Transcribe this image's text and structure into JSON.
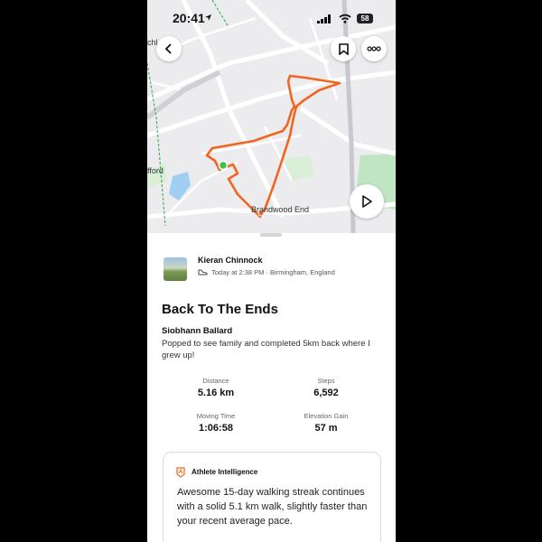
{
  "status_bar": {
    "time": "20:41",
    "battery": "58"
  },
  "map": {
    "labels": {
      "brandwood": "Brandwood End",
      "fford": "fford",
      "chl": "chl"
    },
    "route_color": "#f06620",
    "start_color": "#3ec14a"
  },
  "activity": {
    "athlete_name": "Kieran Chinnock",
    "meta": "Today at 2:38 PM · Birmingham, England",
    "title": "Back To The Ends",
    "tagged": "Siobhann Ballard",
    "description": "Popped to see family and completed 5km back where I grew up!",
    "stats": [
      {
        "label": "Distance",
        "value": "5.16 km"
      },
      {
        "label": "Steps",
        "value": "6,592"
      },
      {
        "label": "Moving Time",
        "value": "1:06:58"
      },
      {
        "label": "Elevation Gain",
        "value": "57 m"
      }
    ]
  },
  "athlete_intelligence": {
    "title": "Athlete Intelligence",
    "text": "Awesome 15-day walking streak continues with a solid 5.1 km walk, slightly faster than your recent average pace."
  },
  "icons": [
    "location-arrow-icon",
    "signal-icon",
    "wifi-icon",
    "battery-icon",
    "back-chevron-icon",
    "bookmark-icon",
    "more-icon",
    "play-icon",
    "shoe-icon",
    "athlete-intelligence-icon"
  ]
}
